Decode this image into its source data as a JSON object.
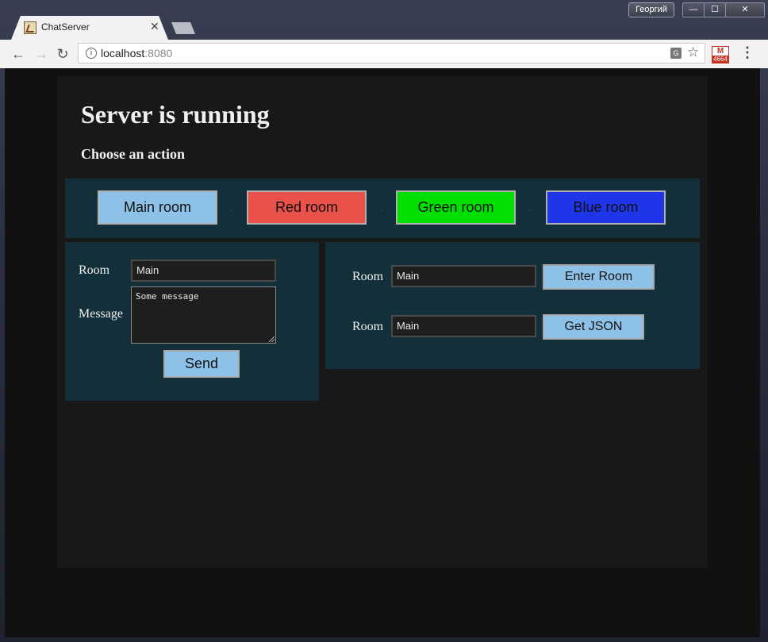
{
  "window": {
    "profile_name": "Георгий",
    "min_glyph": "—",
    "max_glyph": "☐",
    "close_glyph": "✕"
  },
  "tab": {
    "title": "ChatServer",
    "close_glyph": "✕"
  },
  "toolbar": {
    "url_host": "localhost",
    "url_port": ":8080",
    "info_glyph": "i",
    "translate_glyph": "G",
    "gmail_letter": "M",
    "gmail_count": "4664"
  },
  "page": {
    "title": "Server is running",
    "subtitle": "Choose an action"
  },
  "rooms": [
    {
      "label": "Main room",
      "color": "#8ec1e8"
    },
    {
      "label": "Red room",
      "color": "#e8524a"
    },
    {
      "label": "Green room",
      "color": "#00e000"
    },
    {
      "label": "Blue room",
      "color": "#1f35e8"
    }
  ],
  "send_form": {
    "room_label": "Room",
    "room_value": "Main",
    "message_label": "Message",
    "message_value": "Some message",
    "send_label": "Send"
  },
  "room_actions": {
    "enter": {
      "room_label": "Room",
      "room_value": "Main",
      "button_label": "Enter Room"
    },
    "json": {
      "room_label": "Room",
      "room_value": "Main",
      "button_label": "Get JSON"
    }
  }
}
